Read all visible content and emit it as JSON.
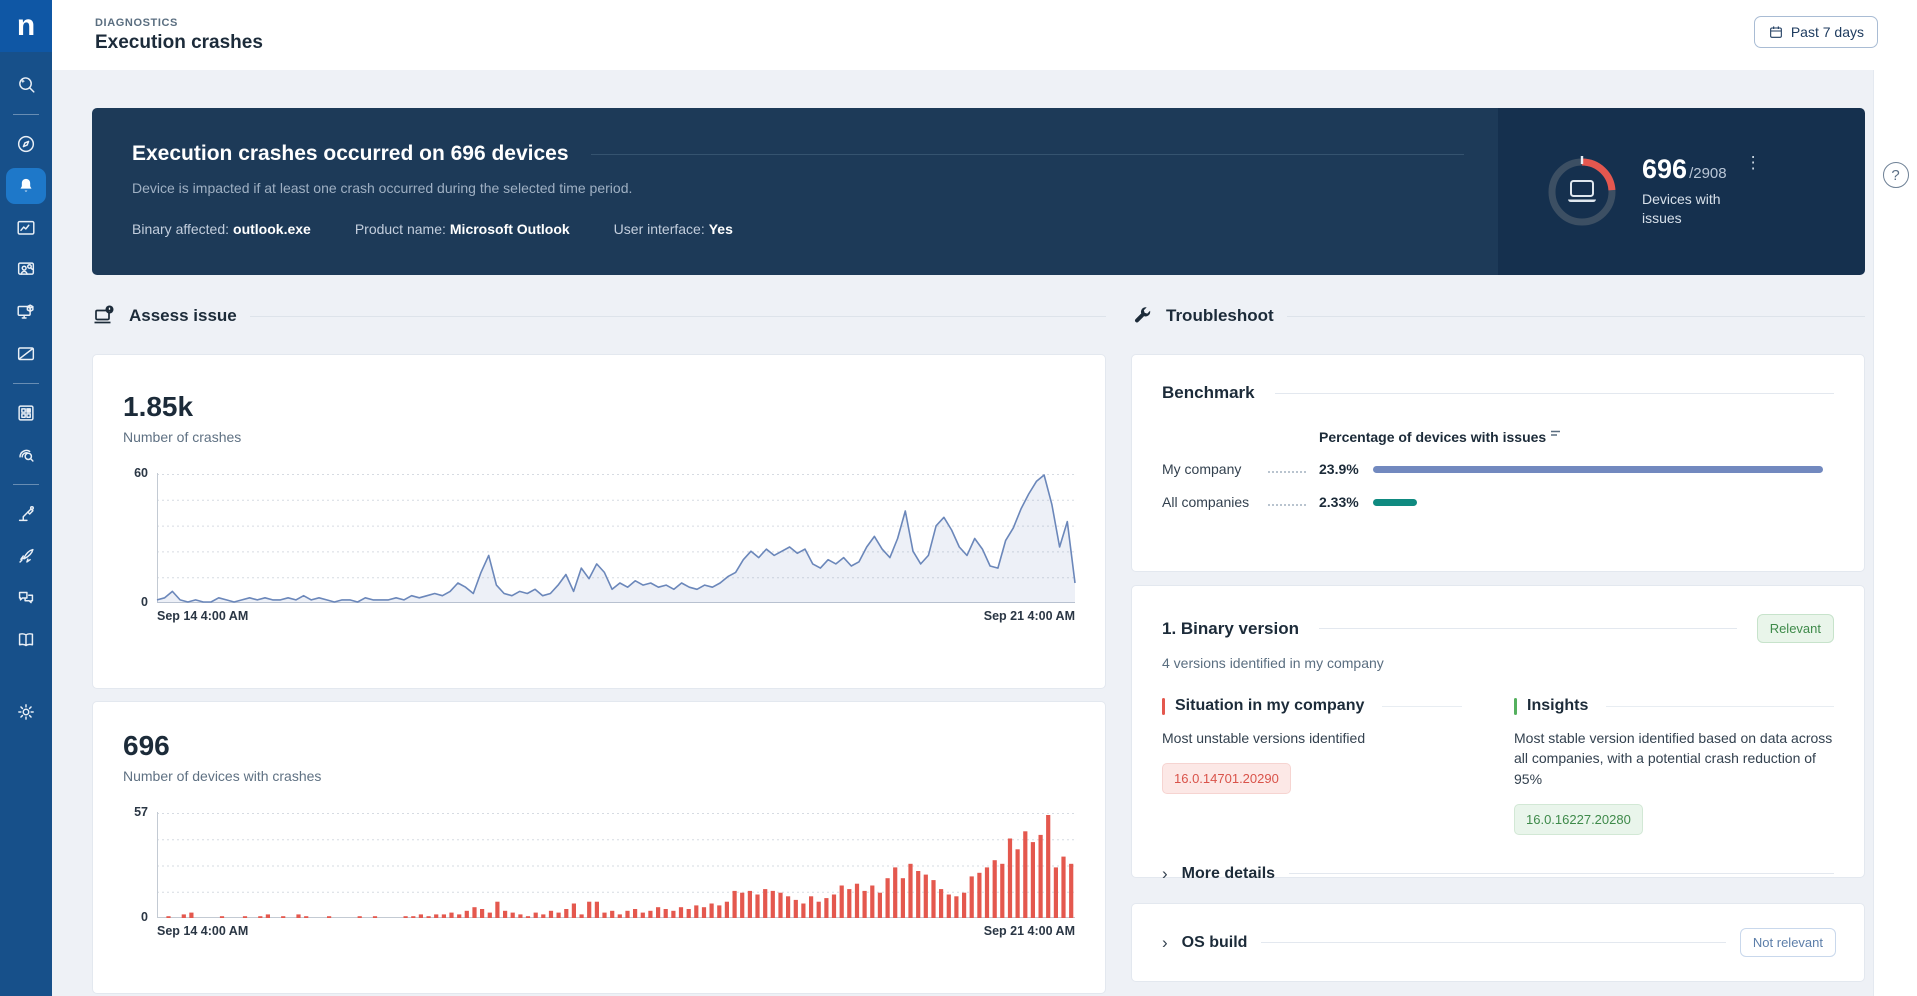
{
  "app": {
    "logo": "n"
  },
  "sidebar": {
    "icons": [
      "ai-search-icon",
      "compass-icon",
      "alerts-bell-icon",
      "monitoring-chart-icon",
      "user-search-icon",
      "remote-device-icon",
      "content-edit-icon",
      "applications-grid-icon",
      "investigate-icon",
      "automation-icon",
      "launch-rocket-icon",
      "feedback-chat-icon",
      "library-book-icon",
      "settings-gear-icon"
    ],
    "active": "alerts-bell-icon"
  },
  "header": {
    "breadcrumb": "DIAGNOSTICS",
    "title": "Execution crashes",
    "period": {
      "label": "Past 7 days",
      "icon": "calendar-icon"
    }
  },
  "banner": {
    "title": "Execution crashes occurred on 696 devices",
    "subtitle": "Device is impacted if at least one crash occurred during the selected time period.",
    "facts": [
      {
        "label": "Binary affected:",
        "value": "outlook.exe"
      },
      {
        "label": "Product name:",
        "value": "Microsoft Outlook"
      },
      {
        "label": "User interface:",
        "value": "Yes"
      }
    ],
    "gauge": {
      "value": "696",
      "total": "/2908",
      "label": "Devices with issues",
      "fraction": 0.239,
      "arc_color": "#e4574f",
      "ring_color": "#3c4f63",
      "icon": "laptop-icon",
      "menu_icon": "kebab-menu-icon",
      "menu_glyph": "⋮"
    }
  },
  "assess": {
    "title": "Assess issue",
    "icon": "laptop-alert-icon",
    "crashes_card": {
      "kpi": "1.85k",
      "label": "Number of crashes"
    },
    "devices_card": {
      "kpi": "696",
      "label": "Number of devices with crashes"
    }
  },
  "troubleshoot": {
    "title": "Troubleshoot",
    "icon": "wrench-icon",
    "benchmark": {
      "title": "Benchmark",
      "column_header": "Percentage of devices with issues"
    },
    "binary": {
      "title": "1. Binary version",
      "badge": "Relevant",
      "subtitle": "4 versions identified in my company",
      "situation": {
        "title": "Situation in my company",
        "body": "Most unstable versions identified",
        "chip": "16.0.14701.20290"
      },
      "insights": {
        "title": "Insights",
        "body": "Most stable version identified based on data across all companies, with a potential crash reduction of 95%",
        "chip": "16.0.16227.20280"
      },
      "more_details": "More details",
      "chevron": "›"
    },
    "os_build": {
      "title": "OS build",
      "badge": "Not relevant",
      "chevron": "›"
    }
  },
  "help": {
    "icon": "help-icon",
    "glyph": "?"
  },
  "chart_data": [
    {
      "id": "crashes",
      "type": "line",
      "title": "Number of crashes",
      "color": "#6b87ba",
      "fill": "rgba(107,135,186,0.12)",
      "ylim": [
        0,
        60
      ],
      "gridlines": 5,
      "y_ticks": [
        "60",
        "0"
      ],
      "x_labels": [
        "Sep 14 4:00 AM",
        "Sep 21 4:00 AM"
      ],
      "values": [
        1,
        2,
        5,
        1,
        0,
        1,
        0,
        0,
        2,
        1,
        0,
        1,
        2,
        1,
        2,
        1,
        1,
        2,
        1,
        3,
        1,
        2,
        1,
        0,
        1,
        1,
        0,
        2,
        1,
        1,
        1,
        2,
        1,
        3,
        2,
        3,
        4,
        3,
        5,
        9,
        7,
        4,
        14,
        22,
        8,
        4,
        3,
        5,
        4,
        6,
        3,
        4,
        8,
        13,
        5,
        16,
        11,
        18,
        14,
        6,
        9,
        7,
        10,
        8,
        9,
        7,
        8,
        6,
        9,
        7,
        6,
        8,
        7,
        9,
        12,
        14,
        20,
        24,
        21,
        25,
        22,
        24,
        26,
        23,
        25,
        18,
        16,
        20,
        18,
        21,
        17,
        19,
        26,
        31,
        25,
        21,
        30,
        43,
        24,
        18,
        22,
        36,
        40,
        34,
        26,
        22,
        30,
        25,
        17,
        16,
        29,
        35,
        44,
        51,
        57,
        60,
        46,
        26,
        38,
        9
      ]
    },
    {
      "id": "devices",
      "type": "bar",
      "title": "Number of devices with crashes",
      "color": "#e4584e",
      "ylim": [
        0,
        57
      ],
      "gridlines": 4,
      "y_ticks": [
        "57",
        "0"
      ],
      "x_labels": [
        "Sep 14 4:00 AM",
        "Sep 21 4:00 AM"
      ],
      "values": [
        0,
        1,
        0,
        2,
        3,
        0,
        0,
        0,
        1,
        0,
        0,
        1,
        0,
        1,
        2,
        0,
        1,
        0,
        2,
        1,
        0,
        0,
        1,
        0,
        0,
        0,
        1,
        0,
        1,
        0,
        0,
        0,
        1,
        1,
        2,
        1,
        2,
        2,
        3,
        2,
        4,
        6,
        5,
        3,
        9,
        4,
        3,
        2,
        1,
        3,
        2,
        4,
        3,
        5,
        8,
        2,
        9,
        9,
        3,
        4,
        2,
        4,
        5,
        3,
        4,
        6,
        5,
        4,
        6,
        5,
        7,
        6,
        8,
        7,
        9,
        15,
        14,
        15,
        13,
        16,
        15,
        14,
        12,
        10,
        8,
        12,
        9,
        11,
        13,
        18,
        16,
        19,
        15,
        18,
        14,
        22,
        28,
        22,
        30,
        26,
        24,
        21,
        16,
        13,
        12,
        14,
        23,
        25,
        28,
        32,
        30,
        44,
        38,
        48,
        42,
        46,
        57,
        28,
        34,
        30
      ]
    },
    {
      "id": "benchmark",
      "type": "hbar",
      "title": "Percentage of devices with issues",
      "categories": [
        "My company",
        "All companies"
      ],
      "values": [
        23.9,
        2.33
      ],
      "value_labels": [
        "23.9%",
        "2.33%"
      ],
      "colors": [
        "#7289bf",
        "#0f8a80"
      ],
      "xlim": [
        0,
        24.5
      ],
      "legend_position": "none",
      "grid": false
    }
  ]
}
